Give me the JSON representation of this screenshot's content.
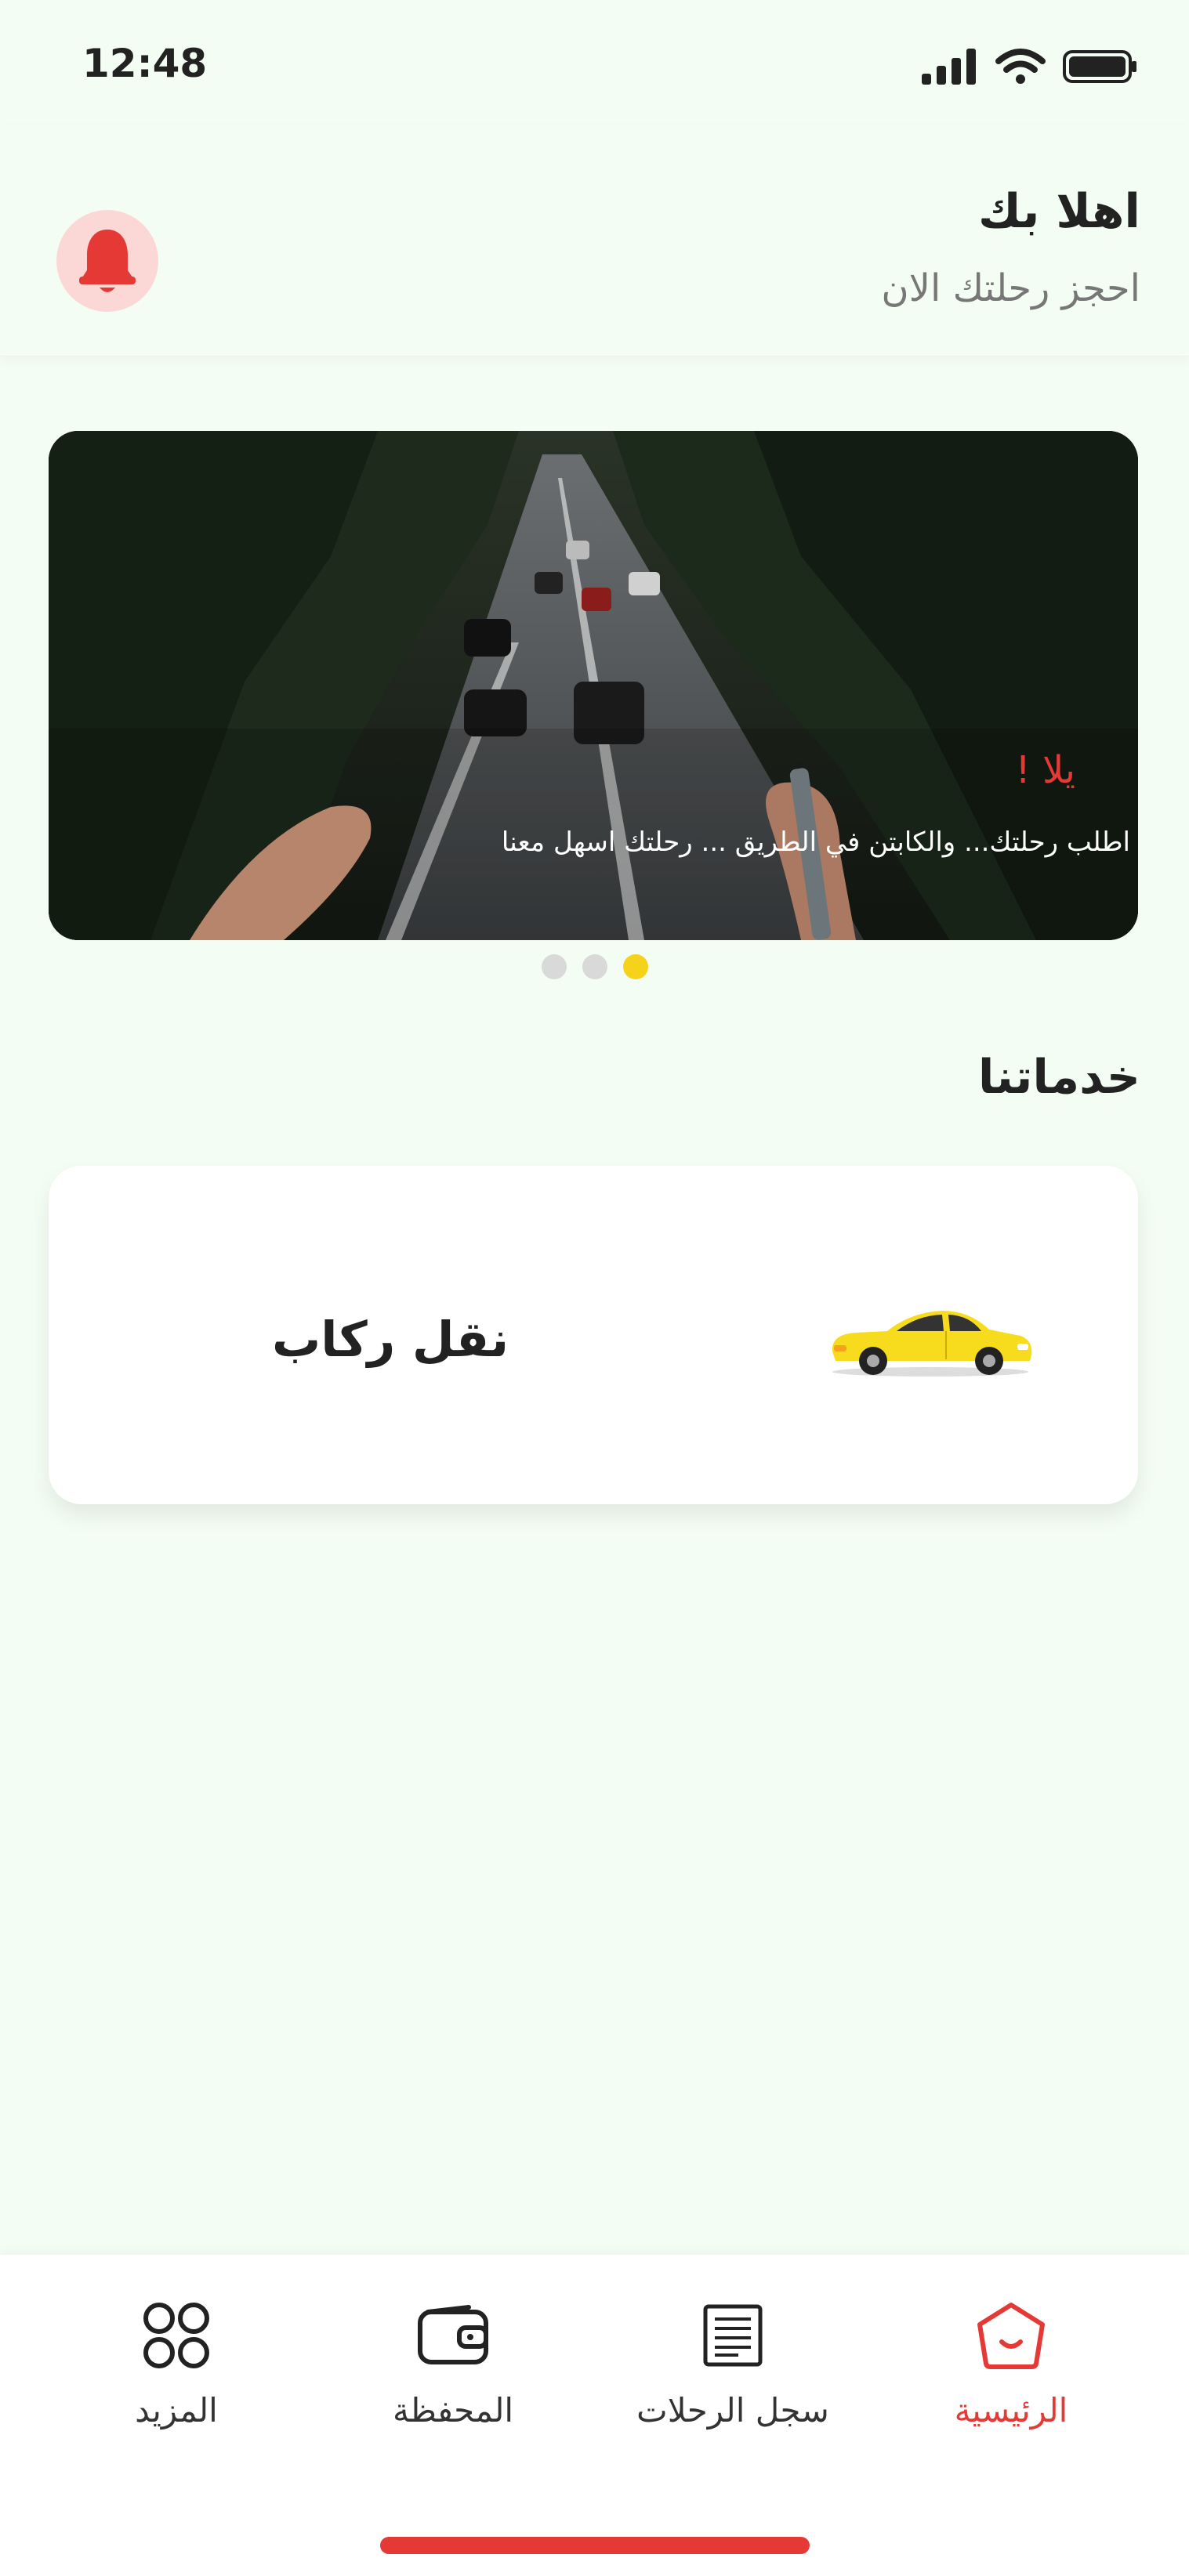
{
  "status_bar": {
    "time": "12:48"
  },
  "header": {
    "greeting": "اهلا بك",
    "subtitle": "احجز رحلتك الان"
  },
  "banner": {
    "title": "يلا !",
    "description": "اطلب رحلتك... والكابتن في الطريق ... رحلتك اسهل معنا",
    "slides_total": 3,
    "active_slide": 3
  },
  "services": {
    "title": "خدماتنا",
    "items": [
      {
        "label": "نقل ركاب",
        "icon": "taxi-car-icon"
      }
    ]
  },
  "bottom_nav": {
    "items": [
      {
        "label": "الرئيسية",
        "icon": "home-icon",
        "active": true
      },
      {
        "label": "سجل الرحلات",
        "icon": "trip-log-icon",
        "active": false
      },
      {
        "label": "المحفظة",
        "icon": "wallet-icon",
        "active": false
      },
      {
        "label": "المزيد",
        "icon": "more-grid-icon",
        "active": false
      }
    ]
  },
  "colors": {
    "accent": "#e53935",
    "background": "#f4fdf3",
    "dot_active": "#f6d21b",
    "taxi_yellow": "#f7dc1e"
  }
}
